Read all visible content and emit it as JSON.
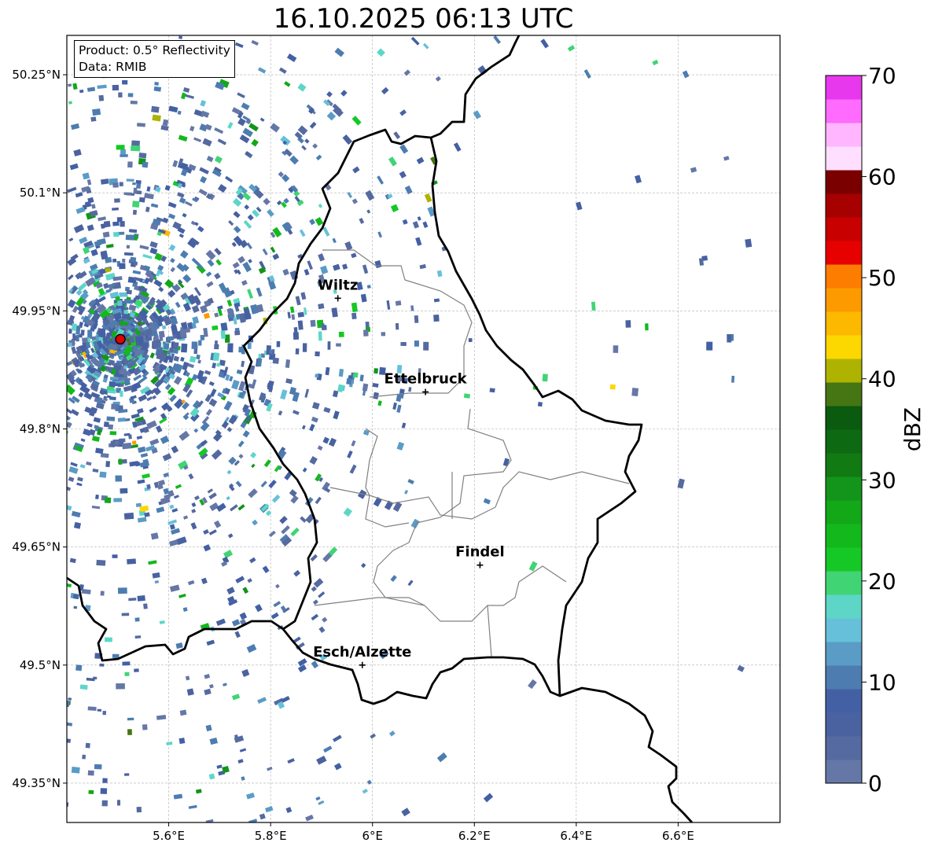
{
  "title": "16.10.2025 06:13 UTC",
  "info": {
    "product": "Product: 0.5° Reflectivity",
    "source": "Data: RMIB"
  },
  "map": {
    "lon_range": [
      5.4,
      6.8
    ],
    "lat_range": [
      49.3,
      50.3
    ],
    "lat_ticks": [
      {
        "value": 50.25,
        "label": "50.25°N"
      },
      {
        "value": 50.1,
        "label": "50.1°N"
      },
      {
        "value": 49.95,
        "label": "49.95°N"
      },
      {
        "value": 49.8,
        "label": "49.8°N"
      },
      {
        "value": 49.65,
        "label": "49.65°N"
      },
      {
        "value": 49.5,
        "label": "49.5°N"
      },
      {
        "value": 49.35,
        "label": "49.35°N"
      }
    ],
    "lon_ticks": [
      {
        "value": 5.6,
        "label": "5.6°E"
      },
      {
        "value": 5.8,
        "label": "5.8°E"
      },
      {
        "value": 6.0,
        "label": "6°E"
      },
      {
        "value": 6.2,
        "label": "6.2°E"
      },
      {
        "value": 6.4,
        "label": "6.4°E"
      },
      {
        "value": 6.6,
        "label": "6.6°E"
      }
    ],
    "gridlines": true,
    "radar_site": {
      "lon": 5.505,
      "lat": 49.914,
      "color": "#e00000"
    },
    "cities": [
      {
        "name": "Wiltz",
        "lon": 5.932,
        "lat": 49.966
      },
      {
        "name": "Ettelbruck",
        "lon": 6.104,
        "lat": 49.847
      },
      {
        "name": "Findel",
        "lon": 6.211,
        "lat": 49.627
      },
      {
        "name": "Esch/Alzette",
        "lon": 5.98,
        "lat": 49.5
      }
    ]
  },
  "colorbar": {
    "label": "dBZ",
    "min": 0,
    "max": 70,
    "step": 2.5,
    "ticks": [
      "0",
      "10",
      "20",
      "30",
      "40",
      "50",
      "60",
      "70"
    ],
    "colors": [
      "#6577a6",
      "#556aa0",
      "#4a62a0",
      "#4460a4",
      "#4d7db0",
      "#5a9cc6",
      "#66c0da",
      "#5dd6c8",
      "#40d474",
      "#16c826",
      "#13b81c",
      "#13a818",
      "#13941a",
      "#117a13",
      "#0d6a13",
      "#0a5a10",
      "#467514",
      "#adb300",
      "#fdd700",
      "#fdb800",
      "#fd9a00",
      "#fd7d00",
      "#e60000",
      "#c80000",
      "#a60000",
      "#7a0000",
      "#ffdfff",
      "#ffb6ff",
      "#ff6aff",
      "#e838ee"
    ]
  },
  "regions": {
    "lux_border_color": "#000000",
    "canton_border_color": "#808080"
  }
}
